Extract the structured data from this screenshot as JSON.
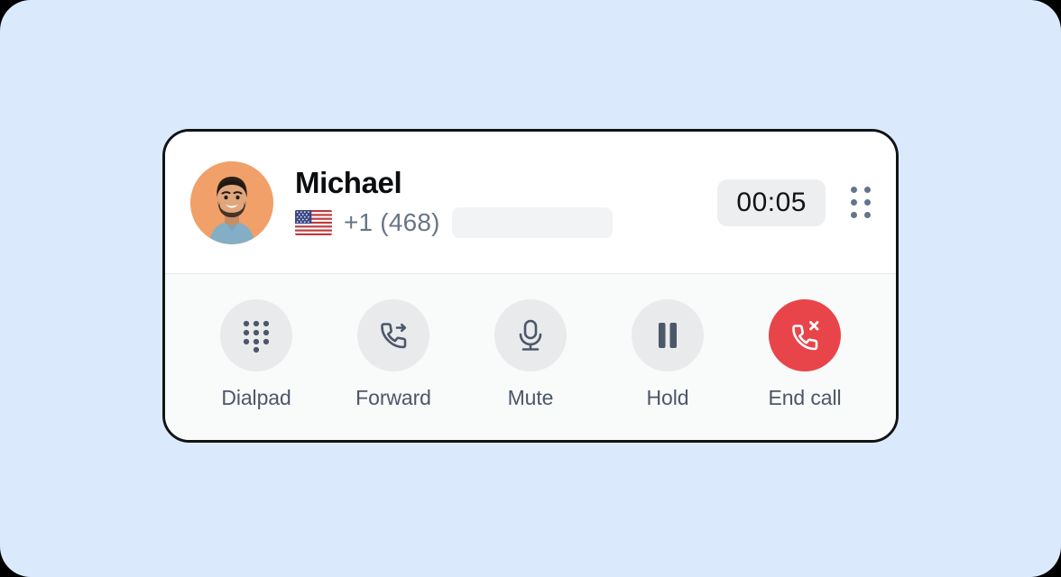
{
  "theme": {
    "page_background": "#daeafc",
    "card_background": "#ffffff",
    "card_border": "#111315",
    "actions_background": "#f9fafa",
    "muted_text": "#4c5768",
    "number_text": "#697586",
    "danger": "#e8454a",
    "icon_circle": "#e8eaec",
    "timer_pill": "#eceef0"
  },
  "caller": {
    "name": "Michael",
    "country_flag": "us-flag-icon",
    "phone_prefix": "+1 (468)",
    "phone_redacted": true,
    "avatar": "avatar-photo-michael"
  },
  "call": {
    "duration": "00:05",
    "drag_handle_icon": "drag-handle-dots-icon"
  },
  "actions": [
    {
      "id": "dialpad",
      "label": "Dialpad",
      "icon": "dialpad-icon",
      "variant": "default"
    },
    {
      "id": "forward",
      "label": "Forward",
      "icon": "call-forward-icon",
      "variant": "default"
    },
    {
      "id": "mute",
      "label": "Mute",
      "icon": "microphone-icon",
      "variant": "default"
    },
    {
      "id": "hold",
      "label": "Hold",
      "icon": "pause-icon",
      "variant": "default"
    },
    {
      "id": "end-call",
      "label": "End call",
      "icon": "call-end-icon",
      "variant": "danger"
    }
  ]
}
